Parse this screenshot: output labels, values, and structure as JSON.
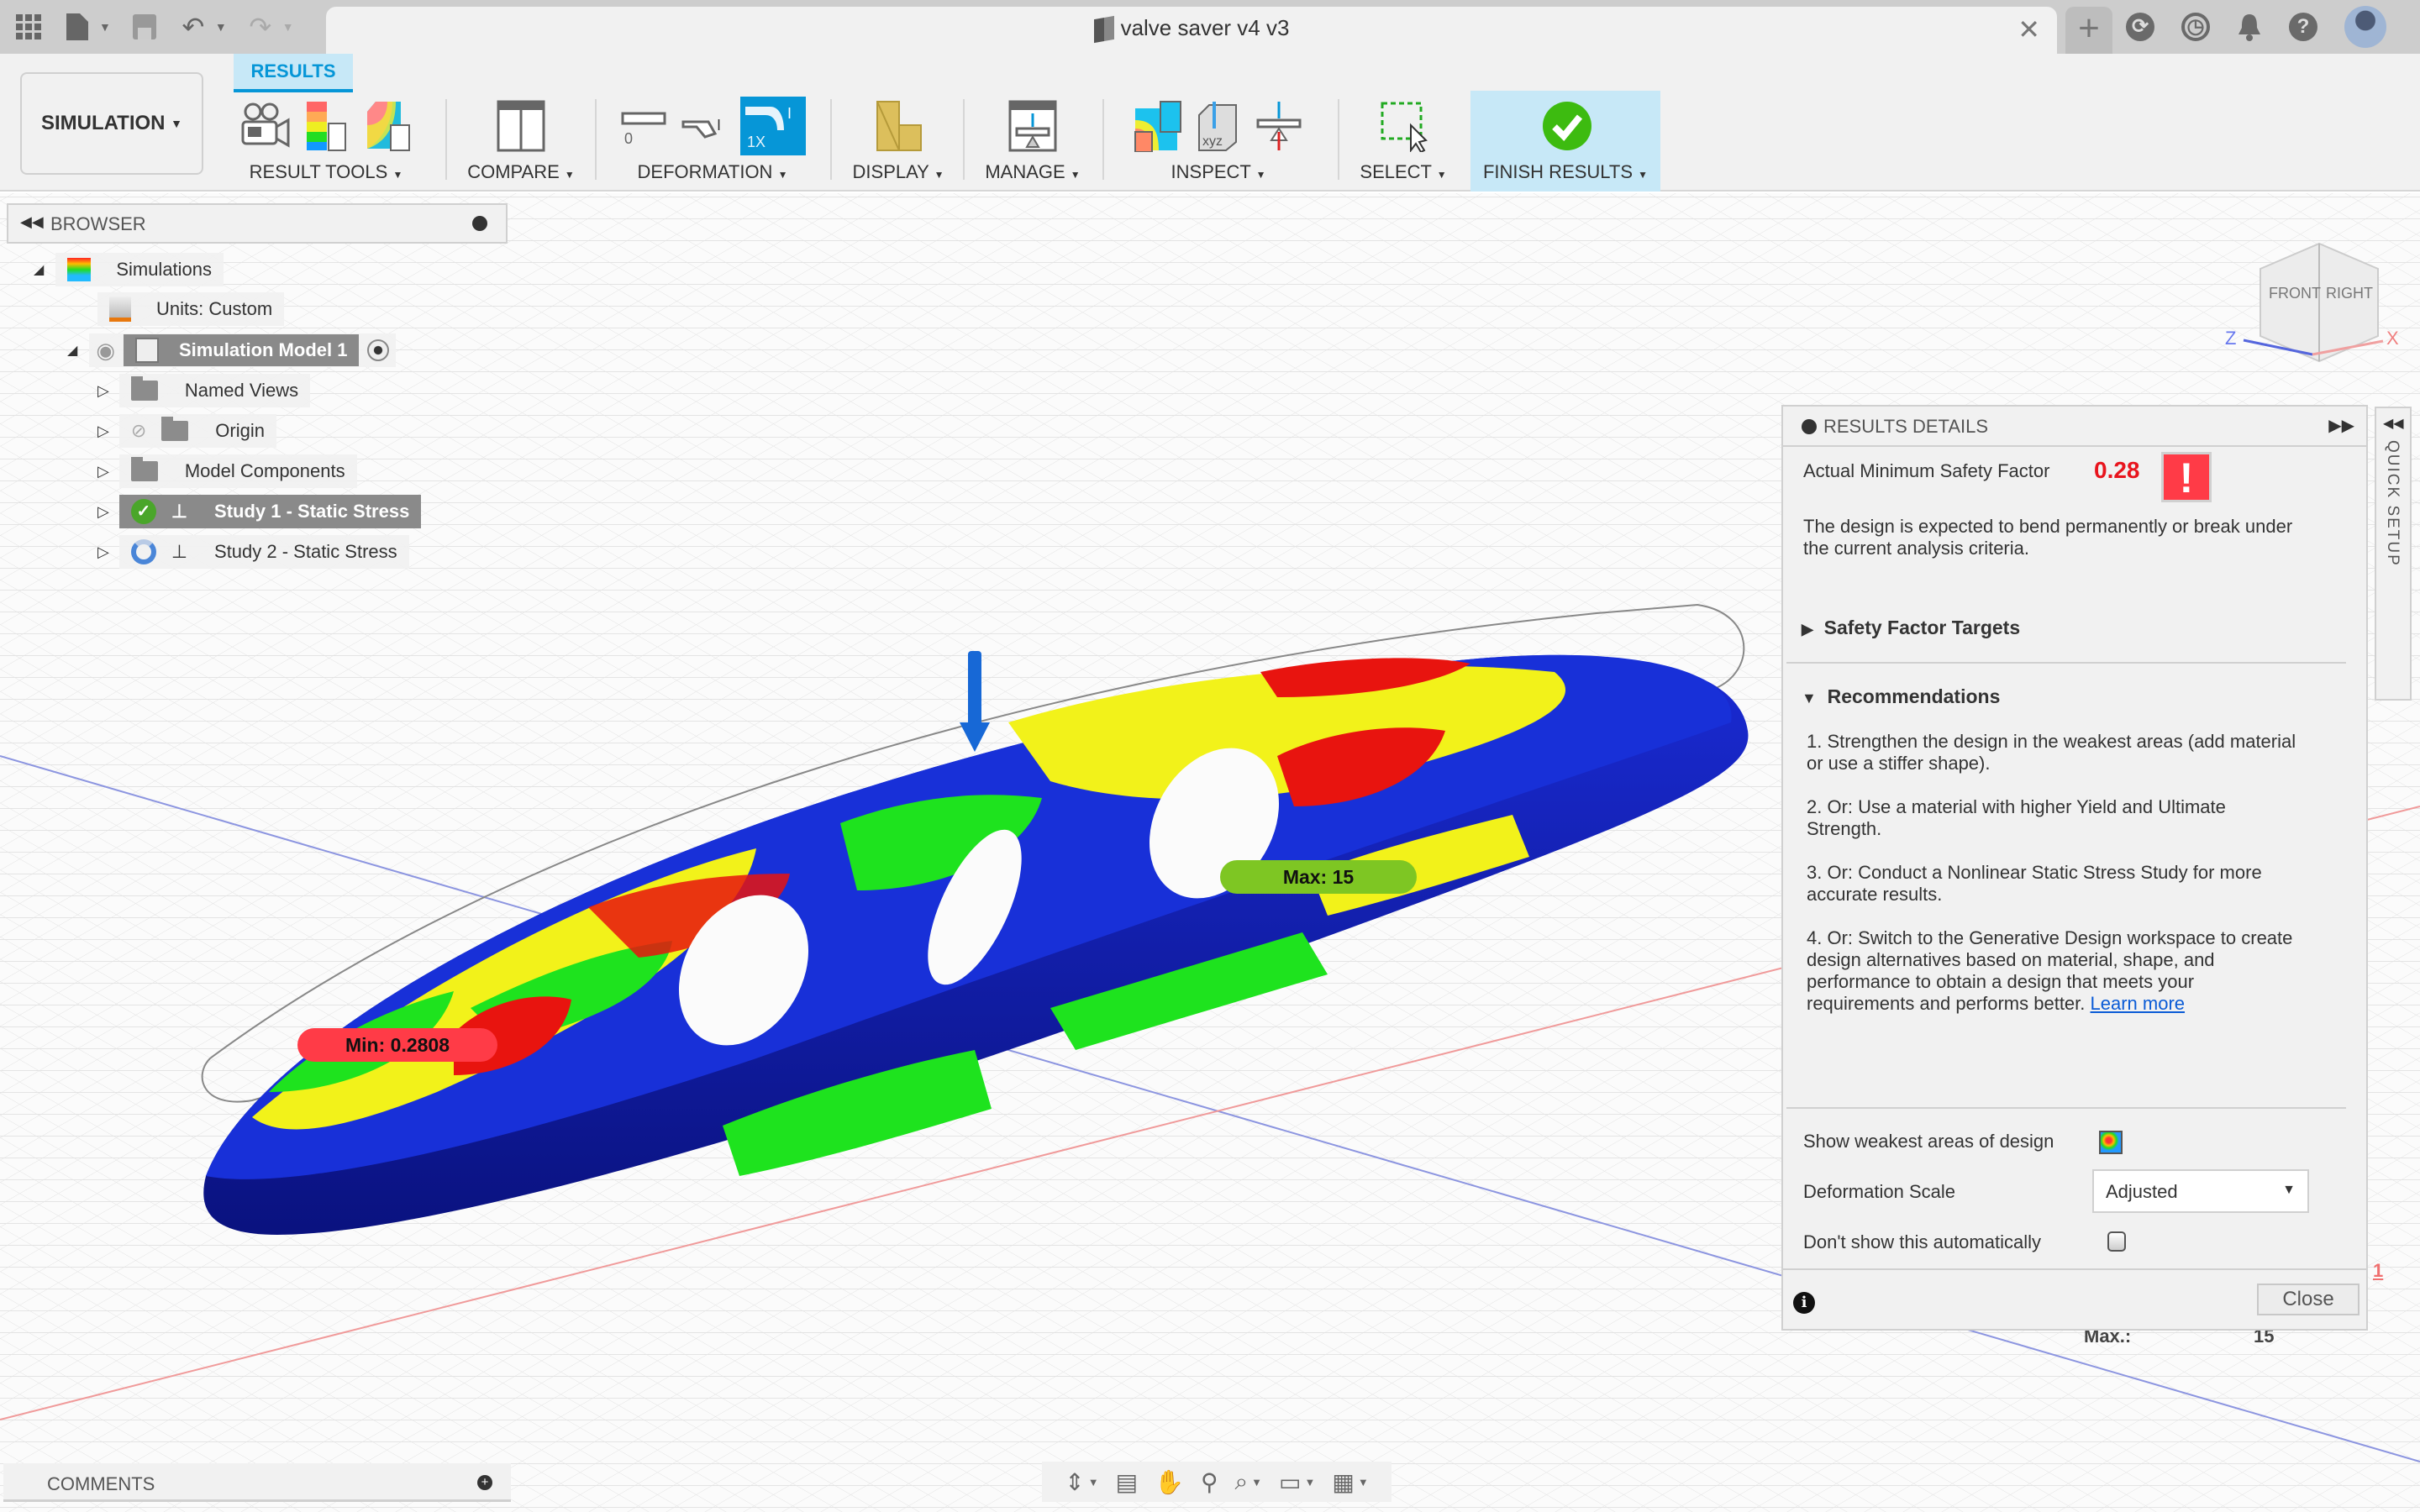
{
  "window": {
    "document_title": "valve saver v4 v3",
    "title_icons": [
      "data-panel-icon",
      "file-icon",
      "save-icon",
      "undo-icon",
      "redo-icon"
    ],
    "right_icons": [
      "new-tab-icon",
      "extensions-icon",
      "job-status-icon",
      "notifications-icon",
      "help-icon",
      "user-avatar"
    ]
  },
  "ribbon": {
    "workspace": "SIMULATION",
    "active_tab": "RESULTS",
    "groups": [
      {
        "label": "RESULT TOOLS"
      },
      {
        "label": "COMPARE"
      },
      {
        "label": "DEFORMATION",
        "active_scale": "1X",
        "zero_label": "0"
      },
      {
        "label": "DISPLAY"
      },
      {
        "label": "MANAGE"
      },
      {
        "label": "INSPECT",
        "probe_text": "xyz"
      },
      {
        "label": "SELECT"
      },
      {
        "label": "FINISH RESULTS"
      }
    ]
  },
  "browser": {
    "title": "BROWSER",
    "items": [
      {
        "label": "Simulations"
      },
      {
        "label": "Units: Custom"
      },
      {
        "label": "Simulation Model 1"
      },
      {
        "label": "Named Views"
      },
      {
        "label": "Origin"
      },
      {
        "label": "Model Components"
      },
      {
        "label": "Study 1 - Static Stress",
        "status": "complete"
      },
      {
        "label": "Study 2 - Static Stress",
        "status": "in-progress"
      }
    ]
  },
  "viewport": {
    "min_label": "Min: 0.2808",
    "max_label": "Max: 15",
    "viewcube": {
      "front": "FRONT",
      "right": "RIGHT",
      "axis_z": "Z",
      "axis_x": "X"
    },
    "legend": {
      "max_label": "Max.:",
      "max_value": "15",
      "marker": "1"
    },
    "colors": {
      "min": "#ff3b47",
      "max": "#7ec623",
      "blue": "#1020c8",
      "green": "#1ee31e",
      "yellow": "#f2f21a",
      "red": "#e8140f"
    }
  },
  "results_details": {
    "title": "RESULTS DETAILS",
    "safety_factor_label": "Actual Minimum Safety Factor",
    "safety_factor_value": "0.28",
    "warning_glyph": "!",
    "message": "The design is expected to bend permanently or break under the current analysis criteria.",
    "safety_targets_label": "Safety Factor Targets",
    "recommendations_label": "Recommendations",
    "recommendations": [
      "1. Strengthen the design in the weakest areas (add material or use a stiffer shape).",
      "2. Or: Use a material with higher Yield and Ultimate Strength.",
      "3. Or: Conduct a Nonlinear Static Stress Study for more accurate results.",
      "4. Or: Switch to the Generative Design workspace to create design alternatives based on material, shape, and performance to obtain a design that meets your requirements and performs better."
    ],
    "learn_more": "Learn more",
    "show_weakest_label": "Show weakest areas of design",
    "deformation_scale_label": "Deformation Scale",
    "deformation_scale_value": "Adjusted",
    "dont_show_label": "Don't show this automatically",
    "dont_show_checked": false,
    "close_label": "Close"
  },
  "quick_setup": {
    "label": "QUICK SETUP"
  },
  "comments": {
    "label": "COMMENTS"
  },
  "nav_bar": {
    "icons": [
      "orbit-icon",
      "look-at-icon",
      "pan-icon",
      "zoom-icon",
      "fit-icon",
      "display-settings-icon",
      "grid-icon"
    ]
  }
}
